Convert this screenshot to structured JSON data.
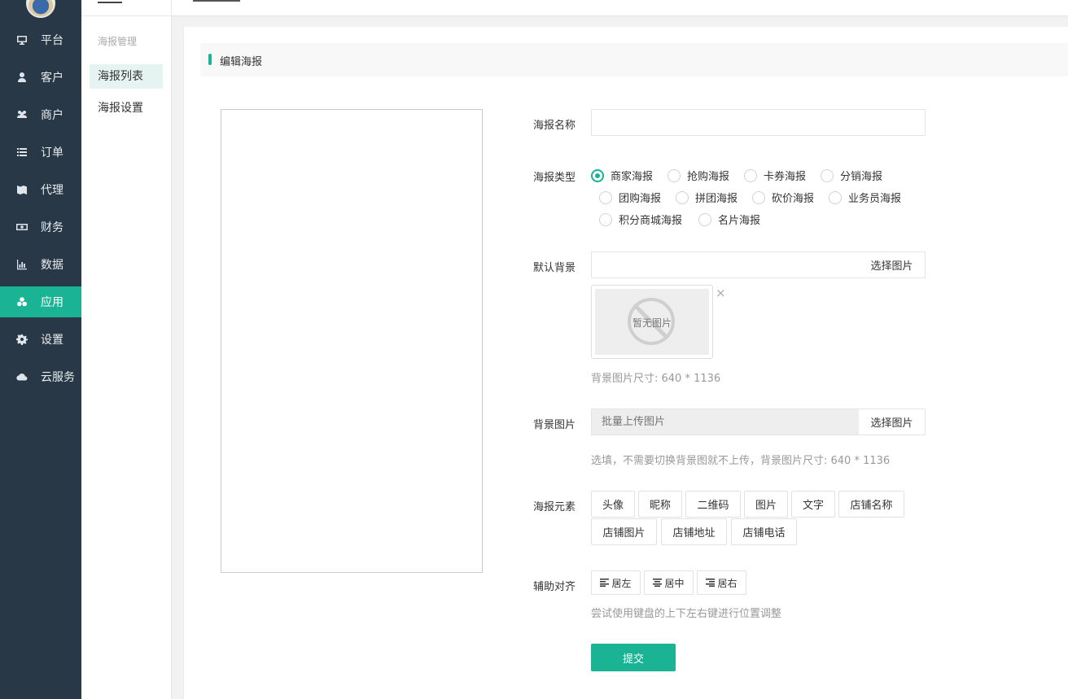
{
  "sidebar": {
    "items": [
      {
        "label": "平台",
        "icon": "monitor-icon"
      },
      {
        "label": "客户",
        "icon": "user-icon"
      },
      {
        "label": "商户",
        "icon": "users-icon"
      },
      {
        "label": "订单",
        "icon": "list-icon"
      },
      {
        "label": "代理",
        "icon": "map-icon"
      },
      {
        "label": "财务",
        "icon": "money-icon"
      },
      {
        "label": "数据",
        "icon": "bar-chart-icon"
      },
      {
        "label": "应用",
        "icon": "cubes-icon"
      },
      {
        "label": "设置",
        "icon": "gear-icon"
      },
      {
        "label": "云服务",
        "icon": "cloud-icon"
      }
    ],
    "active_index": 7
  },
  "subnav": {
    "heading": "海报管理",
    "items": [
      {
        "label": "海报列表"
      },
      {
        "label": "海报设置"
      }
    ],
    "active_index": 0
  },
  "panel": {
    "title": "编辑海报"
  },
  "form": {
    "name": {
      "label": "海报名称",
      "value": ""
    },
    "type": {
      "label": "海报类型",
      "options": [
        "商家海报",
        "抢购海报",
        "卡券海报",
        "分销海报",
        "团购海报",
        "拼团海报",
        "砍价海报",
        "业务员海报",
        "积分商城海报",
        "名片海报"
      ],
      "selected": "商家海报"
    },
    "default_bg": {
      "label": "默认背景",
      "value": "",
      "button": "选择图片",
      "placeholder_text": "暂无图片",
      "close": "×",
      "help": "背景图片尺寸: 640 * 1136"
    },
    "bg_images": {
      "label": "背景图片",
      "placeholder": "批量上传图片",
      "button": "选择图片",
      "help": "选填，不需要切换背景图就不上传，背景图片尺寸: 640 * 1136"
    },
    "elements": {
      "label": "海报元素",
      "buttons": [
        "头像",
        "昵称",
        "二维码",
        "图片",
        "文字",
        "店铺名称",
        "店铺图片",
        "店铺地址",
        "店铺电话"
      ]
    },
    "align": {
      "label": "辅助对齐",
      "buttons": [
        {
          "label": "居左",
          "icon": "align-left-icon"
        },
        {
          "label": "居中",
          "icon": "align-center-icon"
        },
        {
          "label": "居右",
          "icon": "align-right-icon"
        }
      ],
      "help": "尝试使用键盘的上下左右键进行位置调整"
    },
    "submit": "提交"
  },
  "colors": {
    "accent": "#1ab394",
    "sidebar_bg": "#293846"
  }
}
